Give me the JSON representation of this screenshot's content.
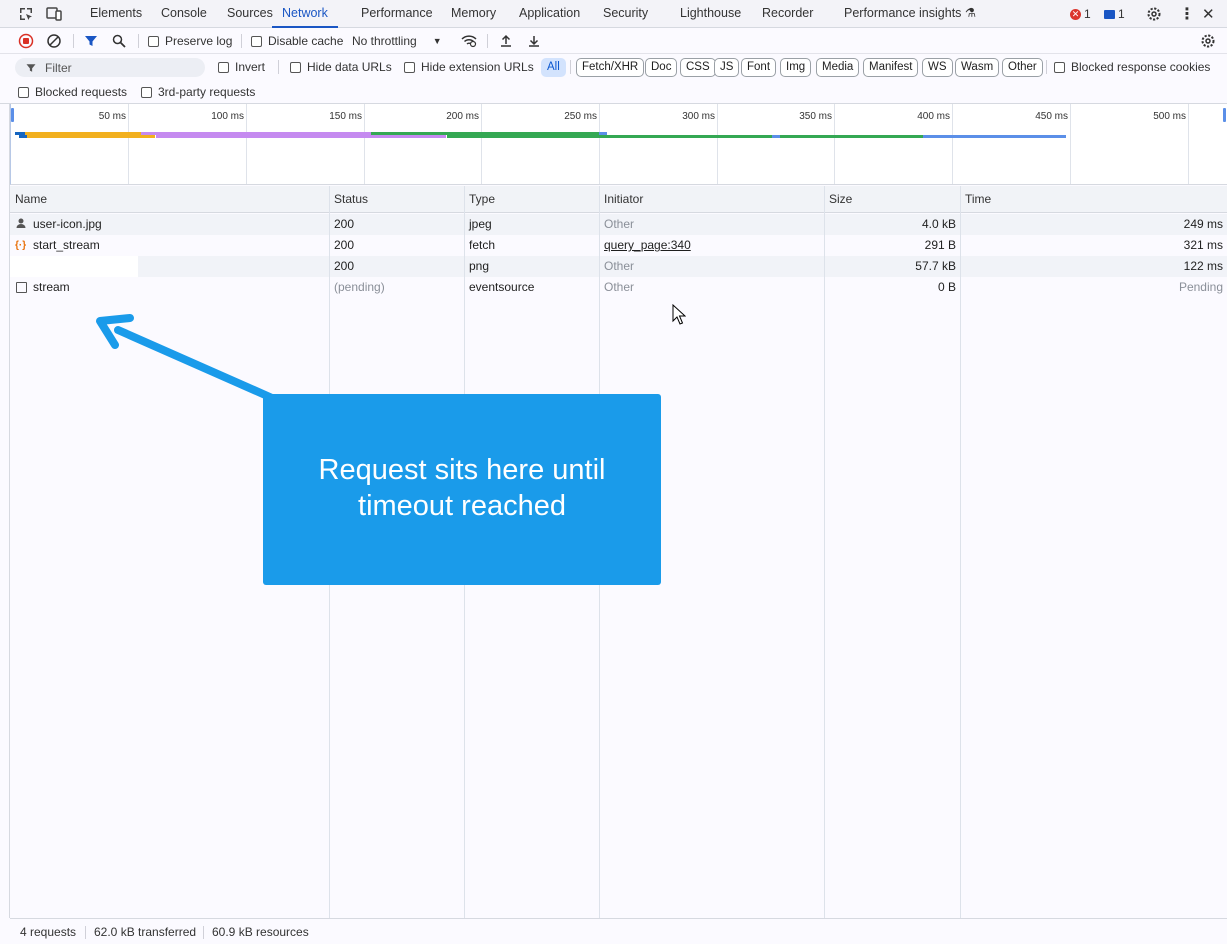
{
  "tabs": [
    {
      "label": "Elements"
    },
    {
      "label": "Console"
    },
    {
      "label": "Sources"
    },
    {
      "label": "Network"
    },
    {
      "label": "Performance"
    },
    {
      "label": "Memory"
    },
    {
      "label": "Application"
    },
    {
      "label": "Security"
    },
    {
      "label": "Lighthouse"
    },
    {
      "label": "Recorder"
    },
    {
      "label": "Performance insights"
    }
  ],
  "active_tab": "Network",
  "badges": {
    "errors": "1",
    "messages": "1"
  },
  "toolbar": {
    "preserve_log": "Preserve log",
    "disable_cache": "Disable cache",
    "throttling": "No throttling"
  },
  "filter": {
    "placeholder": "Filter",
    "invert": "Invert",
    "hide_data_urls": "Hide data URLs",
    "hide_extension_urls": "Hide extension URLs",
    "types": [
      "All",
      "Fetch/XHR",
      "Doc",
      "CSS",
      "JS",
      "Font",
      "Img",
      "Media",
      "Manifest",
      "WS",
      "Wasm",
      "Other"
    ],
    "blocked_response_cookies": "Blocked response cookies",
    "blocked_requests": "Blocked requests",
    "third_party": "3rd-party requests"
  },
  "timeline": {
    "ticks": [
      "50 ms",
      "100 ms",
      "150 ms",
      "200 ms",
      "250 ms",
      "300 ms",
      "350 ms",
      "400 ms",
      "450 ms",
      "500 ms"
    ]
  },
  "table": {
    "columns": [
      "Name",
      "Status",
      "Type",
      "Initiator",
      "Size",
      "Time"
    ],
    "rows": [
      {
        "name": "user-icon.jpg",
        "status": "200",
        "type": "jpeg",
        "initiator": "Other",
        "size": "4.0 kB",
        "time": "249 ms"
      },
      {
        "name": "start_stream",
        "status": "200",
        "type": "fetch",
        "initiator": "query_page:340",
        "size": "291 B",
        "time": "321 ms"
      },
      {
        "name": "",
        "status": "200",
        "type": "png",
        "initiator": "Other",
        "size": "57.7 kB",
        "time": "122 ms"
      },
      {
        "name": "stream",
        "status": "(pending)",
        "type": "eventsource",
        "initiator": "Other",
        "size": "0 B",
        "time": "Pending"
      }
    ]
  },
  "statusbar": {
    "requests": "4 requests",
    "transferred": "62.0 kB transferred",
    "resources": "60.9 kB resources"
  },
  "annotation": {
    "text": "Request sits here until timeout reached"
  },
  "colors": {
    "accent": "#1a56c4",
    "callout": "#1a9bea"
  }
}
